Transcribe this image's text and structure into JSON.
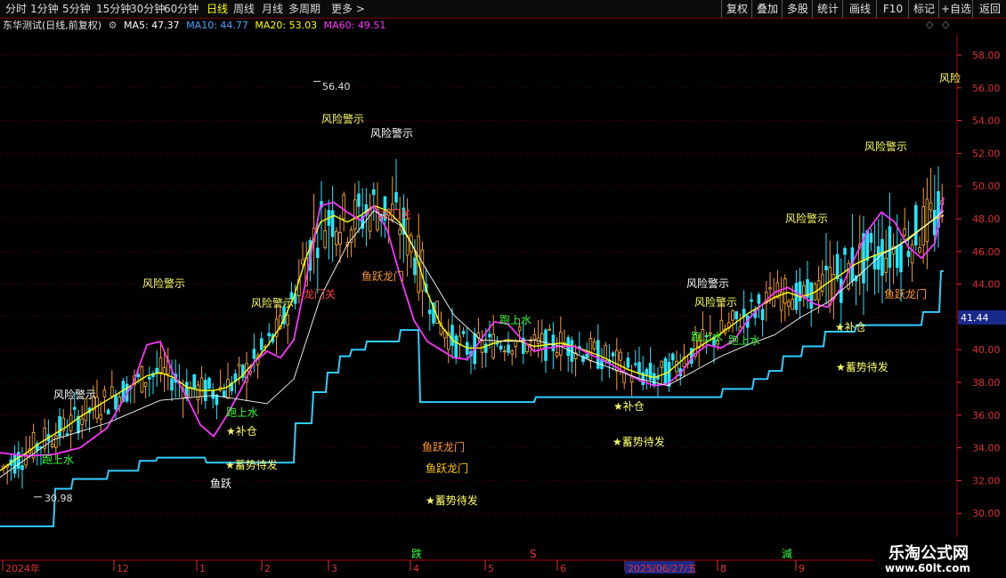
{
  "toolbar": {
    "periods": [
      "分时",
      "1分钟",
      "5分钟",
      "15分钟",
      "30分钟",
      "60分钟",
      "日线",
      "周线",
      "月线",
      "多周期",
      "更多 >"
    ],
    "active": "日线",
    "buttons": [
      "复权",
      "叠加",
      "多股",
      "统计",
      "画线",
      "F10",
      "标记",
      "+自选",
      "返回"
    ]
  },
  "title": {
    "name": "东华测试(日线,前复权)",
    "ma5": "MA5: 47.37",
    "ma10": "MA10: 44.77",
    "ma20": "MA20: 53.03",
    "ma60": "MA60: 49.51"
  },
  "colors": {
    "ma5": "#ffffff",
    "ma10": "#ffff00",
    "ma20": "#ff00ff",
    "ma60": "#00ff00",
    "support": "#33ccff",
    "up": "#ff3333",
    "down": "#00ffff",
    "axis": "#e03030",
    "grid": "#a00000"
  },
  "y_axis": {
    "ticks": [
      "58.00",
      "56.00",
      "54.00",
      "52.00",
      "50.00",
      "48.00",
      "46.00",
      "44.00",
      "42.00",
      "40.00",
      "38.00",
      "36.00",
      "34.00",
      "32.00",
      "30.00"
    ],
    "current_price": "41.44"
  },
  "x_axis": {
    "labels": [
      "2024年",
      "12",
      "1",
      "2",
      "3",
      "4",
      "5",
      "6",
      "2025/06/27/五",
      "8",
      "9"
    ]
  },
  "annotations": {
    "high": "56.40",
    "low": "30.98",
    "risk": "风险警示",
    "fish": "鱼跃",
    "dragon_gate": "鱼跃龙门",
    "gate": "龙门关",
    "water": "跑上水",
    "fill": "补仓",
    "waiting": "蓄势待发",
    "overlap": "鱼跃龙门",
    "risk_edge": "风险"
  },
  "markers": {
    "fall": "跌",
    "s": "S",
    "cut": "減"
  },
  "watermark": {
    "title": "乐淘公式网",
    "url": "www.60lt.com"
  },
  "chart_data": {
    "type": "line",
    "title": "东华测试(日线,前复权)",
    "ylim": [
      29.5,
      58.8
    ],
    "series": [
      {
        "name": "MA5",
        "x": [
          0,
          15,
          30,
          45,
          60,
          75,
          90,
          105,
          120,
          135,
          150,
          165,
          180,
          195,
          210,
          225,
          240,
          255,
          270,
          285,
          300,
          315,
          330,
          345,
          360,
          375,
          390,
          405,
          420,
          435,
          450,
          465,
          480,
          495,
          510,
          525,
          540,
          555,
          570,
          585,
          600,
          615,
          630,
          645,
          660,
          675,
          690,
          705,
          720,
          735,
          750,
          765,
          780,
          795,
          810,
          825,
          840,
          855,
          870,
          885,
          900,
          915,
          930,
          945,
          960,
          975,
          990,
          1005,
          1020,
          1035,
          1050,
          1060
        ],
        "y": [
          32.6,
          33.2,
          33.7,
          34.3,
          34.8,
          35.3,
          35.9,
          36.4,
          36.9,
          37.4,
          37.9,
          38.4,
          38.6,
          38.3,
          37.7,
          37.5,
          37.5,
          37.7,
          38.3,
          39.2,
          40.2,
          41.4,
          43.2,
          45.8,
          47.8,
          48.2,
          47.8,
          48.2,
          48.8,
          48.5,
          47.7,
          46.2,
          43.5,
          41.5,
          40.5,
          40.1,
          40.1,
          40.4,
          40.6,
          40.5,
          40.2,
          40.3,
          40.4,
          40.2,
          39.9,
          39.6,
          39.2,
          38.8,
          38.5,
          38.3,
          38.6,
          39.3,
          40.0,
          40.5,
          41.0,
          41.6,
          42.2,
          42.7,
          43.2,
          43.5,
          43.2,
          43.5,
          44.1,
          44.6,
          45.2,
          45.6,
          45.9,
          46.2,
          46.8,
          47.4,
          48.0,
          48.2
        ]
      },
      {
        "name": "MA20",
        "x": [
          0,
          30,
          60,
          90,
          120,
          150,
          165,
          180,
          195,
          210,
          225,
          240,
          255,
          270,
          285,
          300,
          315,
          330,
          345,
          360,
          375,
          390,
          405,
          420,
          435,
          450,
          465,
          480,
          495,
          510,
          525,
          540,
          555,
          570,
          585,
          600,
          615,
          630,
          645,
          660,
          675,
          690,
          705,
          720,
          735,
          750,
          765,
          780,
          795,
          810,
          825,
          840,
          855,
          870,
          885,
          900,
          915,
          930,
          945,
          960,
          975,
          990,
          1005,
          1020,
          1035,
          1050,
          1060
        ],
        "y": [
          33.7,
          33.5,
          33.6,
          34.0,
          35.2,
          38.0,
          40.3,
          40.5,
          38.5,
          37.1,
          35.4,
          34.7,
          36.0,
          37.5,
          39.2,
          39.9,
          39.5,
          40.6,
          44.6,
          48.8,
          49.0,
          48.4,
          47.9,
          48.8,
          47.3,
          44.4,
          41.8,
          40.5,
          40.0,
          39.5,
          39.4,
          40.6,
          41.7,
          41.6,
          40.7,
          39.9,
          40.1,
          40.2,
          40.2,
          39.8,
          39.4,
          39.0,
          38.5,
          38.1,
          37.8,
          37.9,
          38.6,
          39.7,
          40.3,
          40.1,
          40.6,
          41.8,
          42.7,
          43.5,
          43.8,
          43.3,
          42.8,
          42.6,
          43.8,
          45.6,
          47.3,
          48.4,
          47.8,
          46.3,
          45.6,
          46.5,
          49.3
        ]
      },
      {
        "name": "MA60",
        "x": [
          0,
          60,
          120,
          180,
          240,
          300,
          330,
          360,
          390,
          420,
          450,
          480,
          510,
          540,
          570,
          600,
          630,
          660,
          690,
          720,
          750,
          780,
          810,
          840,
          870,
          900,
          930,
          960,
          990,
          1020,
          1060
        ],
        "y": [
          32.2,
          34.5,
          35.5,
          36.9,
          37.2,
          36.7,
          38.2,
          43.2,
          46.4,
          48.5,
          47.6,
          44.8,
          42.1,
          40.6,
          40.5,
          40.6,
          40.2,
          39.4,
          38.8,
          38.2,
          37.8,
          38.7,
          39.6,
          40.3,
          40.9,
          42.0,
          42.9,
          44.3,
          45.8,
          46.7,
          48.5
        ]
      },
      {
        "name": "Support",
        "x": [
          0,
          60,
          62,
          80,
          82,
          120,
          122,
          155,
          157,
          175,
          177,
          230,
          232,
          330,
          332,
          350,
          352,
          366,
          368,
          380,
          382,
          393,
          395,
          410,
          412,
          448,
          450,
          470,
          472,
          478,
          480,
          600,
          602,
          700,
          702,
          760,
          762,
          810,
          812,
          845,
          847,
          862,
          864,
          878,
          880,
          900,
          902,
          925,
          927,
          960,
          962,
          1035,
          1037,
          1055,
          1057,
          1060
        ],
        "y": [
          29.2,
          29.2,
          31.5,
          31.5,
          32.1,
          32.1,
          32.6,
          32.6,
          33.2,
          33.2,
          33.4,
          33.4,
          33.1,
          33.1,
          35.5,
          35.5,
          37.4,
          37.4,
          38.6,
          38.6,
          39.6,
          39.6,
          40.0,
          40.0,
          40.5,
          40.5,
          41.2,
          41.2,
          36.8,
          36.8,
          36.8,
          36.8,
          37.1,
          37.1,
          37.1,
          37.1,
          37.1,
          37.1,
          37.6,
          37.6,
          38.2,
          38.2,
          38.7,
          38.7,
          39.6,
          39.6,
          40.2,
          40.2,
          41.1,
          41.1,
          41.5,
          41.5,
          42.3,
          42.3,
          44.8,
          44.8
        ]
      }
    ]
  }
}
